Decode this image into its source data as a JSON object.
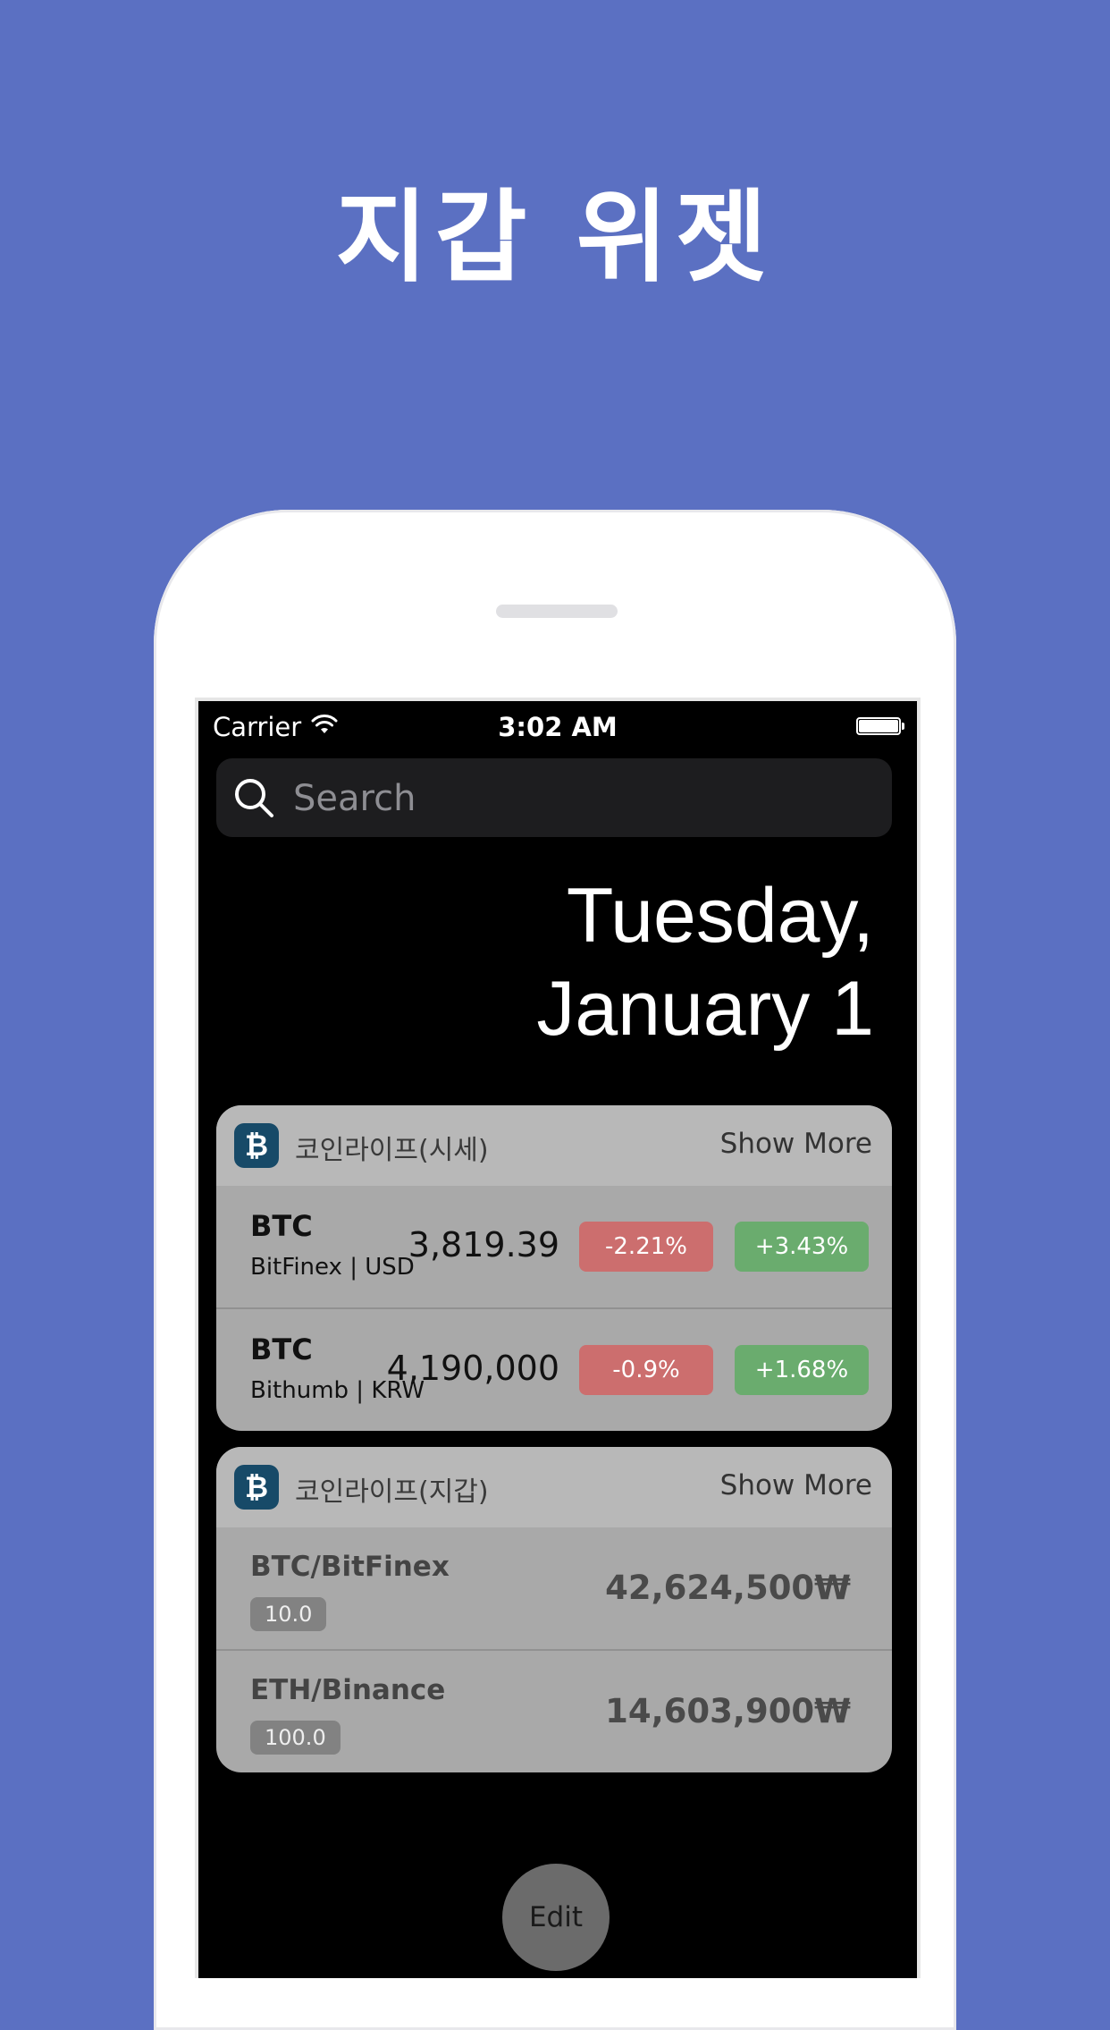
{
  "headline": "지갑 위젯",
  "status_bar": {
    "carrier": "Carrier",
    "time": "3:02 AM",
    "wifi_icon": "wifi-icon",
    "battery_icon": "battery-icon"
  },
  "search": {
    "placeholder": "Search",
    "icon": "search-icon"
  },
  "date": {
    "line1": "Tuesday,",
    "line2": "January 1"
  },
  "price_widget": {
    "title": "코인라이프(시세)",
    "show_more": "Show More",
    "icon": "bitcoin-icon",
    "icon_glyph": "₿",
    "rows": [
      {
        "coin": "BTC",
        "market": "BitFinex | USD",
        "price": "3,819.39",
        "change1": "-2.21%",
        "change2": "+3.43%"
      },
      {
        "coin": "BTC",
        "market": "Bithumb | KRW",
        "price": "4,190,000",
        "change1": "-0.9%",
        "change2": "+1.68%"
      }
    ]
  },
  "wallet_widget": {
    "title": "코인라이프(지갑)",
    "show_more": "Show More",
    "icon": "bitcoin-icon",
    "icon_glyph": "₿",
    "rows": [
      {
        "pair": "BTC/BitFinex",
        "quantity": "10.0",
        "value": "42,624,500₩"
      },
      {
        "pair": "ETH/Binance",
        "quantity": "100.0",
        "value": "14,603,900₩"
      }
    ]
  },
  "edit_label": "Edit",
  "colors": {
    "background": "#5b70c2",
    "negative": "#cc6e6e",
    "positive": "#6aac6e",
    "app_icon": "#174a68"
  }
}
